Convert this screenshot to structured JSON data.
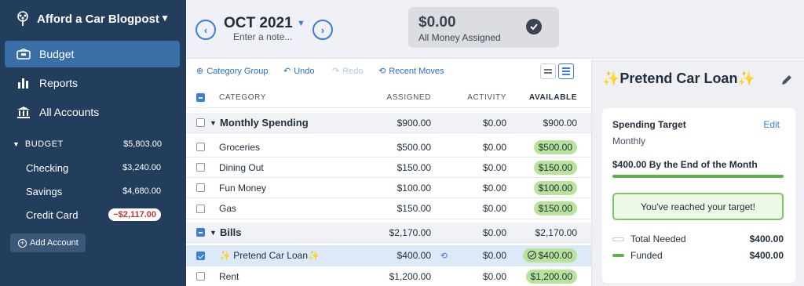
{
  "sidebar": {
    "brand": "Afford a Car Blogpost",
    "nav": {
      "budget": "Budget",
      "reports": "Reports",
      "accounts": "All Accounts"
    },
    "budget_section": {
      "label": "BUDGET",
      "total": "$5,803.00",
      "accounts": [
        {
          "name": "Checking",
          "balance": "$3,240.00"
        },
        {
          "name": "Savings",
          "balance": "$4,680.00"
        },
        {
          "name": "Credit Card",
          "balance": "−$2,117.00"
        }
      ]
    },
    "add_account": "Add Account"
  },
  "header": {
    "month": "OCT 2021",
    "note_placeholder": "Enter a note...",
    "assigned_amount": "$0.00",
    "assigned_label": "All Money Assigned"
  },
  "toolbar": {
    "category_group": "Category Group",
    "undo": "Undo",
    "redo": "Redo",
    "recent_moves": "Recent Moves"
  },
  "table": {
    "columns": {
      "category": "CATEGORY",
      "assigned": "ASSIGNED",
      "activity": "ACTIVITY",
      "available": "AVAILABLE"
    },
    "groups": [
      {
        "name": "Monthly Spending",
        "assigned": "$900.00",
        "activity": "$0.00",
        "available": "$900.00",
        "rows": [
          {
            "name": "Groceries",
            "assigned": "$500.00",
            "activity": "$0.00",
            "available": "$500.00"
          },
          {
            "name": "Dining Out",
            "assigned": "$150.00",
            "activity": "$0.00",
            "available": "$150.00"
          },
          {
            "name": "Fun Money",
            "assigned": "$100.00",
            "activity": "$0.00",
            "available": "$100.00"
          },
          {
            "name": "Gas",
            "assigned": "$150.00",
            "activity": "$0.00",
            "available": "$150.00"
          }
        ]
      },
      {
        "name": "Bills",
        "assigned": "$2,170.00",
        "activity": "$0.00",
        "available": "$2,170.00",
        "rows": [
          {
            "name": "✨ Pretend Car Loan✨",
            "assigned": "$400.00",
            "activity": "$0.00",
            "available": "$400.00"
          },
          {
            "name": "Rent",
            "assigned": "$1,200.00",
            "activity": "$0.00",
            "available": "$1,200.00"
          }
        ]
      }
    ]
  },
  "inspector": {
    "title": "✨Pretend Car Loan✨",
    "target_label": "Spending Target",
    "edit": "Edit",
    "frequency": "Monthly",
    "goal": "$400.00 By the End of the Month",
    "progress": 1.0,
    "reached": "You've reached your target!",
    "total_needed_label": "Total Needed",
    "total_needed": "$400.00",
    "funded_label": "Funded",
    "funded": "$400.00"
  },
  "colors": {
    "sidebar": "#233d5c",
    "active_nav": "#3a6fa6",
    "accent": "#3b7dd8",
    "funded_pill": "#b9e39a",
    "negative": "#c0392b"
  }
}
